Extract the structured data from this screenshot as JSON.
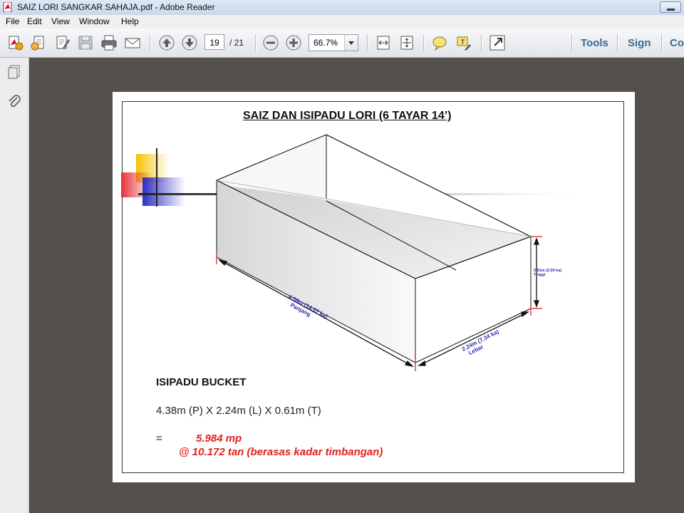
{
  "window": {
    "title": "SAIZ LORI SANGKAR SAHAJA.pdf - Adobe Reader"
  },
  "menu": [
    "File",
    "Edit",
    "View",
    "Window",
    "Help"
  ],
  "toolbar": {
    "page_current": "19",
    "page_total": "/ 21",
    "zoom": "66.7%",
    "links": [
      "Tools",
      "Sign",
      "Co"
    ]
  },
  "document": {
    "heading": "SAIZ DAN ISIPADU LORI (6 TAYAR 14’)",
    "dim_length": "4.38m (14.37 ka)",
    "dim_length_label": "Panjang",
    "dim_width": "2.24m (7.34 ka)",
    "dim_width_label": "Lebar",
    "dim_height": "0.61m (2.00 ka)",
    "dim_height_label": "Tinggi",
    "section_title": "ISIPADU  BUCKET",
    "formula": "4.38m (P) X 2.24m (L) X 0.61m (T)",
    "equals": "=",
    "result": "5.984 mp",
    "result_note": "@ 10.172 tan (berasas kadar timbangan)"
  },
  "colors": {
    "link": "#3a6b98",
    "result_red": "#e0211b",
    "dim_blue": "#2a2ab8",
    "accent_yellow": "#f5c400",
    "accent_red": "#e8313a",
    "accent_blue": "#2f2fc8"
  }
}
